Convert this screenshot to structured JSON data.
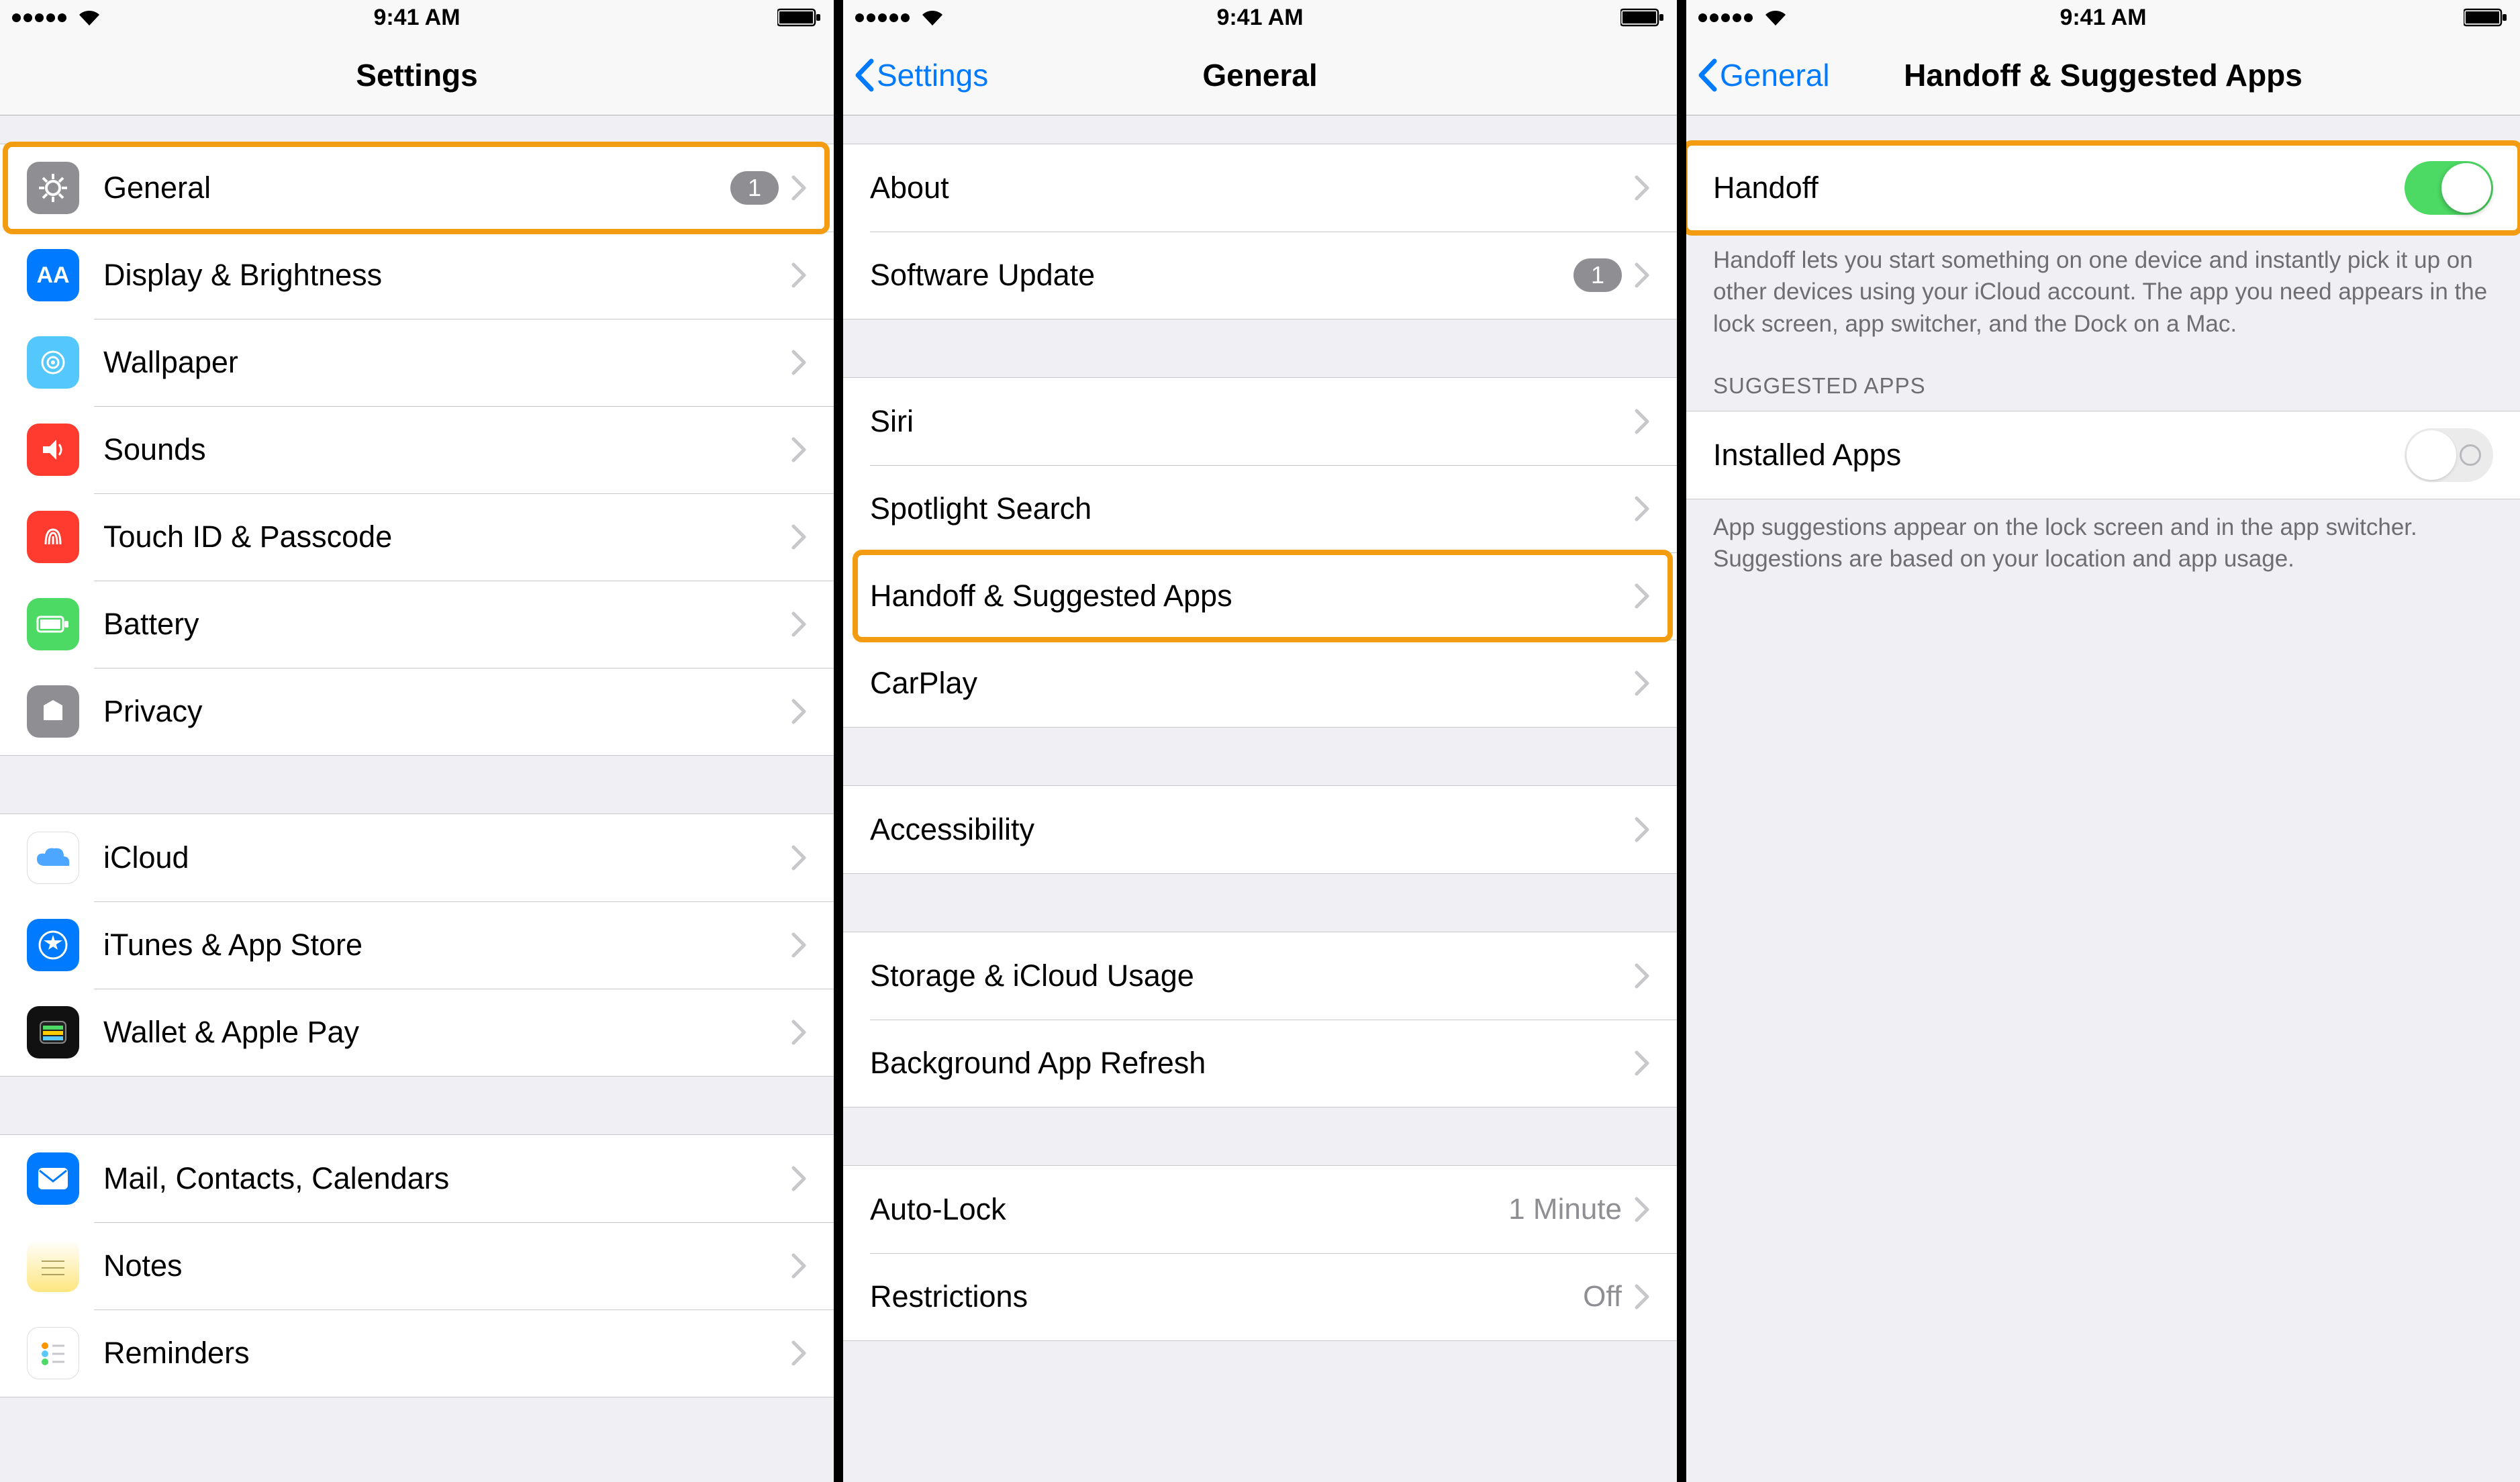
{
  "status": {
    "time": "9:41 AM"
  },
  "screen1": {
    "title": "Settings",
    "groups": [
      [
        {
          "id": "general",
          "label": "General",
          "badge": "1",
          "hl": true
        },
        {
          "id": "display",
          "label": "Display & Brightness"
        },
        {
          "id": "wallpaper",
          "label": "Wallpaper"
        },
        {
          "id": "sounds",
          "label": "Sounds"
        },
        {
          "id": "touchid",
          "label": "Touch ID & Passcode"
        },
        {
          "id": "battery",
          "label": "Battery"
        },
        {
          "id": "privacy",
          "label": "Privacy"
        }
      ],
      [
        {
          "id": "icloud",
          "label": "iCloud"
        },
        {
          "id": "itunes",
          "label": "iTunes & App Store"
        },
        {
          "id": "wallet",
          "label": "Wallet & Apple Pay"
        }
      ],
      [
        {
          "id": "mail",
          "label": "Mail, Contacts, Calendars"
        },
        {
          "id": "notes",
          "label": "Notes"
        },
        {
          "id": "reminders",
          "label": "Reminders"
        }
      ]
    ]
  },
  "screen2": {
    "back": "Settings",
    "title": "General",
    "groups": [
      [
        {
          "id": "about",
          "label": "About"
        },
        {
          "id": "swupdate",
          "label": "Software Update",
          "badge": "1"
        }
      ],
      [
        {
          "id": "siri",
          "label": "Siri"
        },
        {
          "id": "spotlight",
          "label": "Spotlight Search"
        },
        {
          "id": "handoff",
          "label": "Handoff & Suggested Apps",
          "hl": true
        },
        {
          "id": "carplay",
          "label": "CarPlay"
        }
      ],
      [
        {
          "id": "accessibility",
          "label": "Accessibility"
        }
      ],
      [
        {
          "id": "storage",
          "label": "Storage & iCloud Usage"
        },
        {
          "id": "bgrefresh",
          "label": "Background App Refresh"
        }
      ],
      [
        {
          "id": "autolock",
          "label": "Auto-Lock",
          "value": "1 Minute"
        },
        {
          "id": "restrictions",
          "label": "Restrictions",
          "value": "Off"
        }
      ]
    ]
  },
  "screen3": {
    "back": "General",
    "title": "Handoff & Suggested Apps",
    "handoff_label": "Handoff",
    "handoff_on": true,
    "handoff_footer": "Handoff lets you start something on one device and instantly pick it up on other devices using your iCloud account. The app you need appears in the lock screen, app switcher, and the Dock on a Mac.",
    "suggested_header": "SUGGESTED APPS",
    "installed_label": "Installed Apps",
    "installed_on": false,
    "suggested_footer": "App suggestions appear on the lock screen and in the app switcher. Suggestions are based on your location and app usage."
  }
}
